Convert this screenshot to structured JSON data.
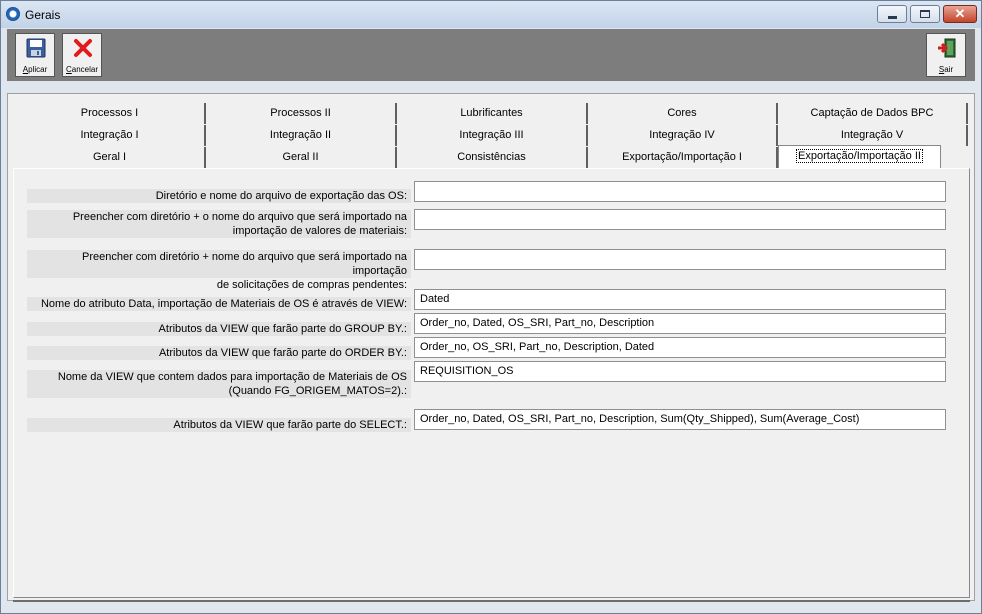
{
  "window": {
    "title": "Gerais"
  },
  "toolbar": {
    "apply_label_first": "A",
    "apply_label_rest": "plicar",
    "cancel_label_first": "C",
    "cancel_label_rest": "ancelar",
    "exit_label_first": "S",
    "exit_label_rest": "air"
  },
  "tabs": {
    "row1": [
      "Processos I",
      "Processos II",
      "Lubrificantes",
      "Cores",
      "Captação de Dados BPC"
    ],
    "row2": [
      "Integração I",
      "Integração II",
      "Integração III",
      "Integração IV",
      "Integração V"
    ],
    "row3": [
      "Geral I",
      "Geral II",
      "Consistências",
      "Exportação/Importação I",
      "Exportação/Importação II"
    ]
  },
  "form": {
    "label_export_file": "Diretório e nome do arquivo de exportação das OS:",
    "label_import_materials_1": "Preencher com diretório + o nome do arquivo que será importado na",
    "label_import_materials_2": "importação de valores de materiais:",
    "label_import_requests_1": "Preencher com diretório + nome do arquivo que será importado na importação",
    "label_import_requests_2": "de solicitações de compras pendentes:",
    "label_date_attr": "Nome do atributo Data, importação de Materiais de OS é através de VIEW:",
    "label_group_by": "Atributos da VIEW que farão parte do GROUP BY.:",
    "label_order_by": "Atributos da VIEW que farão parte do ORDER BY.:",
    "label_view_name_1": "Nome da VIEW que contem dados para importação de Materiais de OS",
    "label_view_name_2": "(Quando FG_ORIGEM_MATOS=2).:",
    "label_select": "Atributos da VIEW que farão parte do SELECT.:",
    "value_export_file": "",
    "value_import_materials": "",
    "value_import_requests": "",
    "value_date_attr": "Dated",
    "value_group_by": "Order_no, Dated, OS_SRI, Part_no, Description",
    "value_order_by": "Order_no, OS_SRI, Part_no, Description, Dated",
    "value_view_name": "REQUISITION_OS",
    "value_select": "Order_no, Dated, OS_SRI, Part_no, Description, Sum(Qty_Shipped), Sum(Average_Cost)"
  }
}
